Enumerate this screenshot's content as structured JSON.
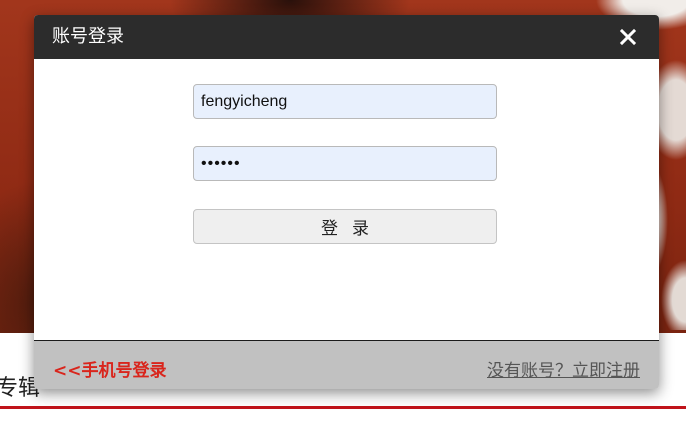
{
  "background": {
    "section_label": "专辑",
    "accent_color": "#c0131a"
  },
  "modal": {
    "title": "账号登录",
    "close_icon": "close-icon",
    "username": {
      "value": "fengyicheng"
    },
    "password": {
      "value": "••••••"
    },
    "login_label": "登录",
    "footer": {
      "phone_login_label": "<<手机号登录",
      "register_label": "没有账号？立即注册",
      "link_color": "#d9251c"
    }
  }
}
